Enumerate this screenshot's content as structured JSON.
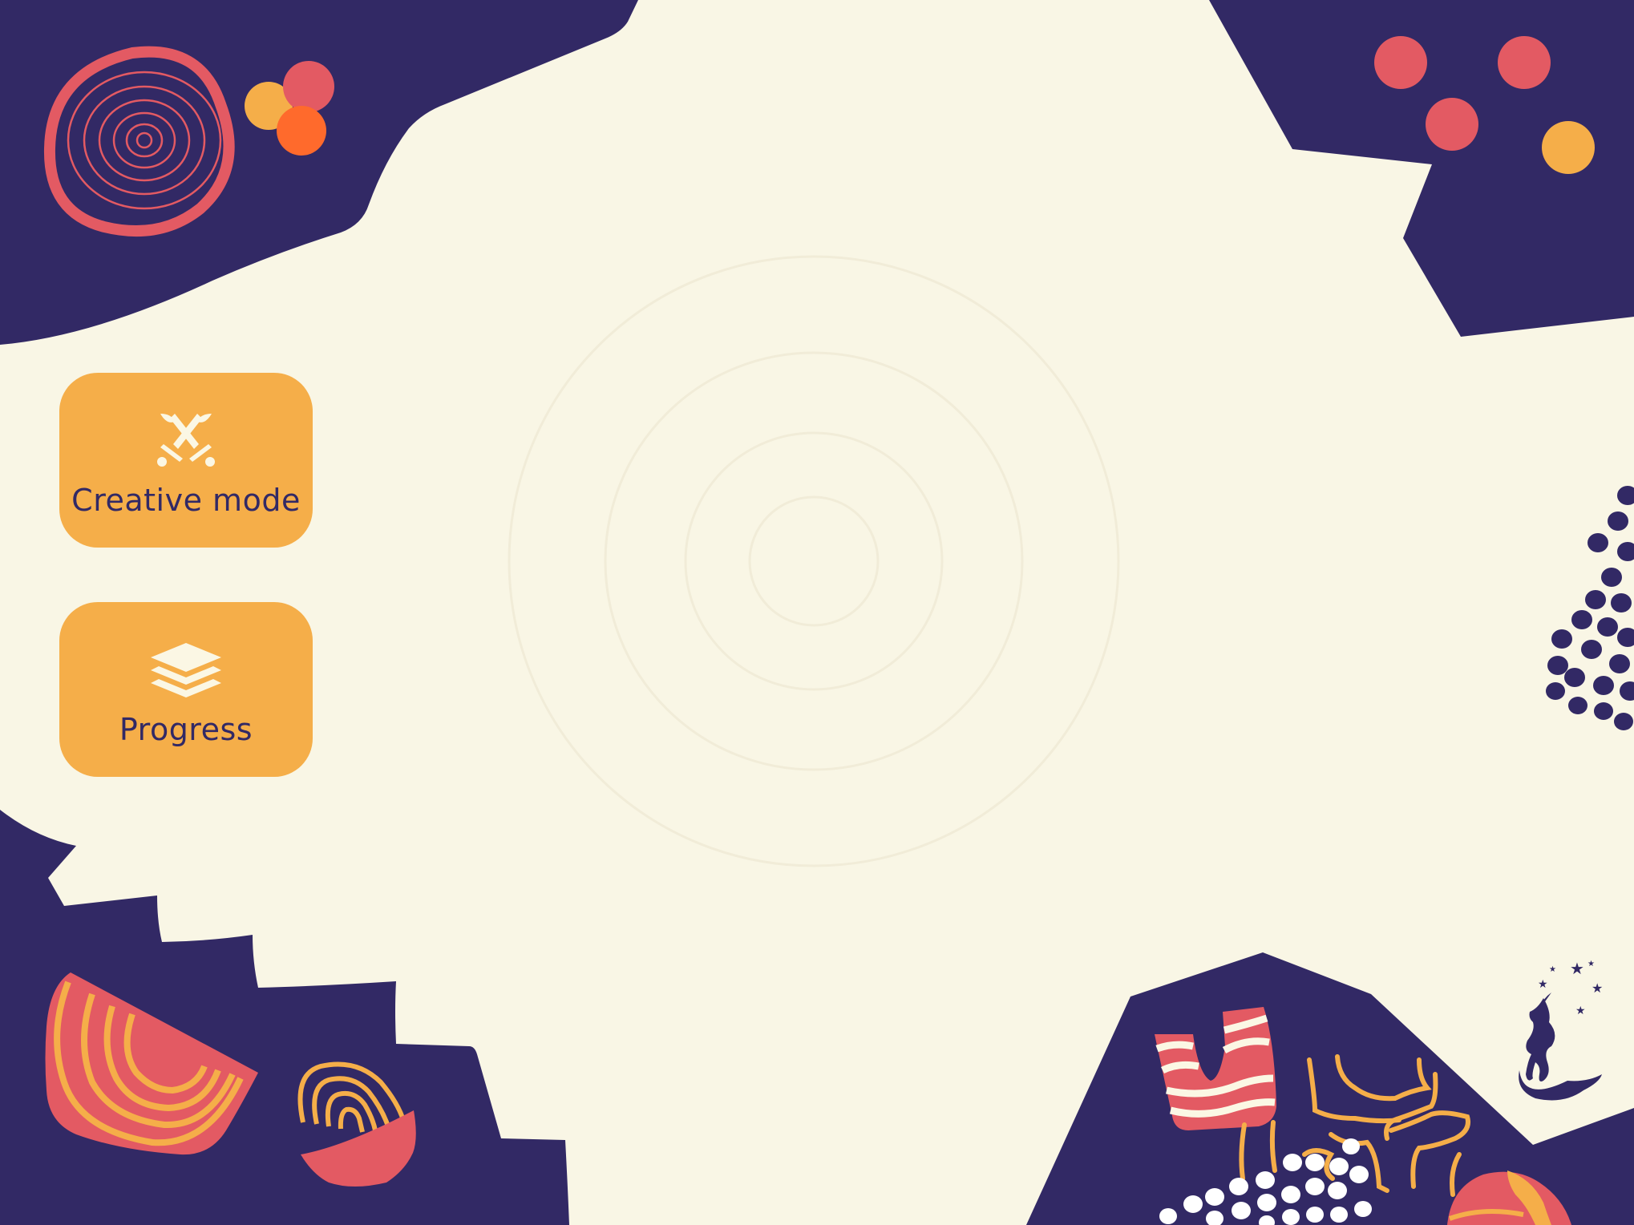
{
  "menu": {
    "items": [
      {
        "label": "Creative mode",
        "icon": "crossed-swords-icon"
      },
      {
        "label": "Progress",
        "icon": "layers-stack-icon"
      }
    ]
  },
  "colors": {
    "background": "#f9f6e5",
    "navy": "#322965",
    "coral": "#e35a63",
    "orange": "#f5ae49",
    "bright_orange": "#ff6a2c",
    "cream": "#fbf7e4"
  }
}
